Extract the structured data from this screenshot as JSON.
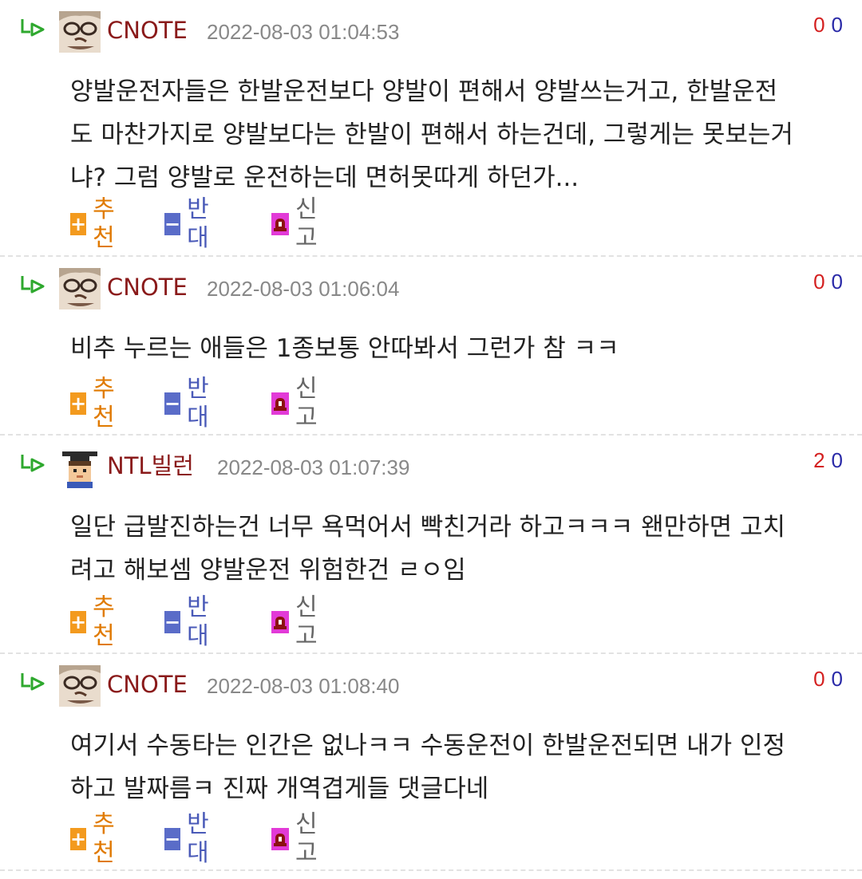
{
  "actions": {
    "recommend": "추천",
    "oppose": "반대",
    "report": "신고"
  },
  "comments": [
    {
      "author": "CNOTE",
      "timestamp": "2022-08-03 01:04:53",
      "up": "0",
      "down": "0",
      "lines": [
        "양발운전자들은 한발운전보다 양발이 편해서 양발쓰는거고, 한발운전",
        "도 마찬가지로 양발보다는 한발이 편해서 하는건데, 그렇게는 못보는거",
        "냐? 그럼 양발로 운전하는데 면허못따게 하던가..."
      ]
    },
    {
      "author": "CNOTE",
      "timestamp": "2022-08-03 01:06:04",
      "up": "0",
      "down": "0",
      "lines": [
        "비추 누르는 애들은 1종보통 안따봐서 그런가 참 ㅋㅋ"
      ]
    },
    {
      "author": "NTL빌런",
      "timestamp": "2022-08-03 01:07:39",
      "up": "2",
      "down": "0",
      "lines": [
        "일단 급발진하는건 너무 욕먹어서 빡친거라 하고ㅋㅋㅋ 왠만하면 고치",
        "려고 해보셈 양발운전 위험한건 ㄹㅇ임"
      ]
    },
    {
      "author": "CNOTE",
      "timestamp": "2022-08-03 01:08:40",
      "up": "0",
      "down": "0",
      "lines": [
        "여기서 수동타는 인간은 없나ㅋㅋ 수동운전이 한발운전되면 내가 인정",
        "하고 발짜름ㅋ 진짜 개역겹게들 댓글다네"
      ]
    }
  ],
  "colors": {
    "author": "#8a1a1a",
    "vote_up": "#d42020",
    "vote_down": "#2a2aa8",
    "recommend": "#e07a00",
    "oppose": "#4a5ab8",
    "reply_arrow": "#2ea82e"
  },
  "icons": {
    "reply": "reply-arrow-icon",
    "avatar_cnote": "face-avatar",
    "avatar_ntl": "pixel-graduate-avatar",
    "plus": "plus-icon",
    "minus": "minus-icon",
    "report": "siren-icon"
  }
}
